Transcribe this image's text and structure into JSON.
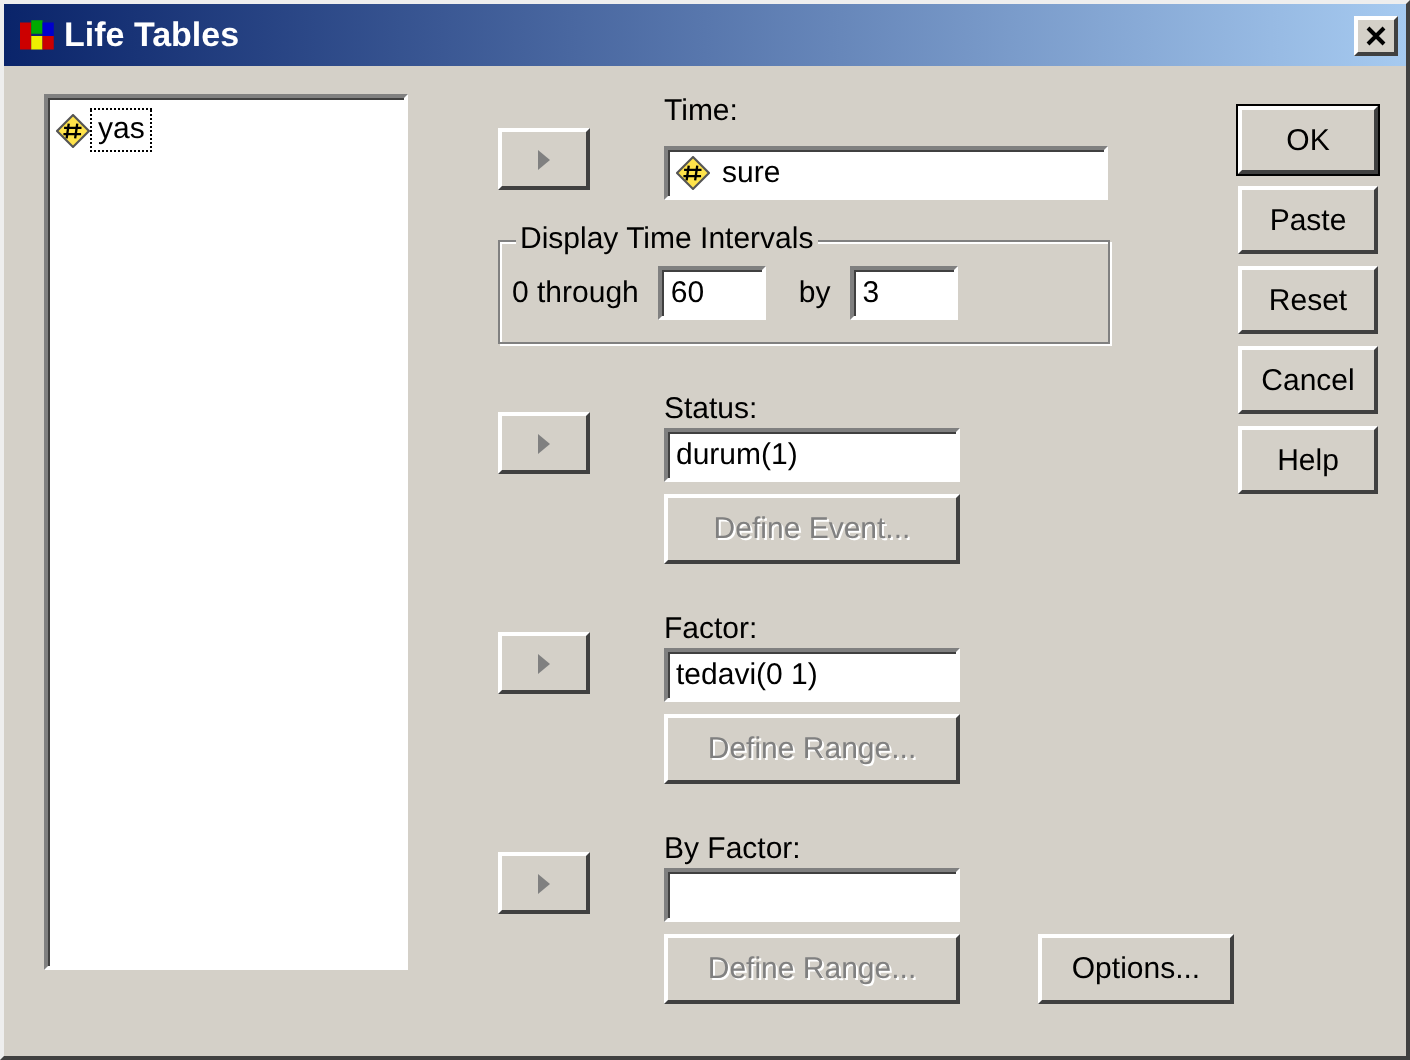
{
  "window": {
    "title": "Life Tables"
  },
  "variables": [
    {
      "name": "yas",
      "kind": "numeric",
      "focused": true
    }
  ],
  "time": {
    "label": "Time:",
    "value": "sure",
    "kind": "numeric"
  },
  "intervals": {
    "title": "Display Time Intervals",
    "through_label": "0 through",
    "through_value": "60",
    "by_label": "by",
    "by_value": "3"
  },
  "sections": [
    {
      "label": "Status:",
      "value": "durum(1)",
      "button": {
        "label": "Define Event...",
        "disabled": true
      }
    },
    {
      "label": "Factor:",
      "value": "tedavi(0 1)",
      "button": {
        "label": "Define Range...",
        "disabled": true
      }
    },
    {
      "label": "By Factor:",
      "button": {
        "label": "Define Range...",
        "disabled": true
      }
    }
  ],
  "options": {
    "label": "Options..."
  },
  "buttons": [
    {
      "label": "OK",
      "default": true
    },
    {
      "label": "Paste",
      "default": false
    },
    {
      "label": "Reset",
      "default": false
    },
    {
      "label": "Cancel",
      "default": false
    },
    {
      "label": "Help",
      "default": false
    }
  ]
}
